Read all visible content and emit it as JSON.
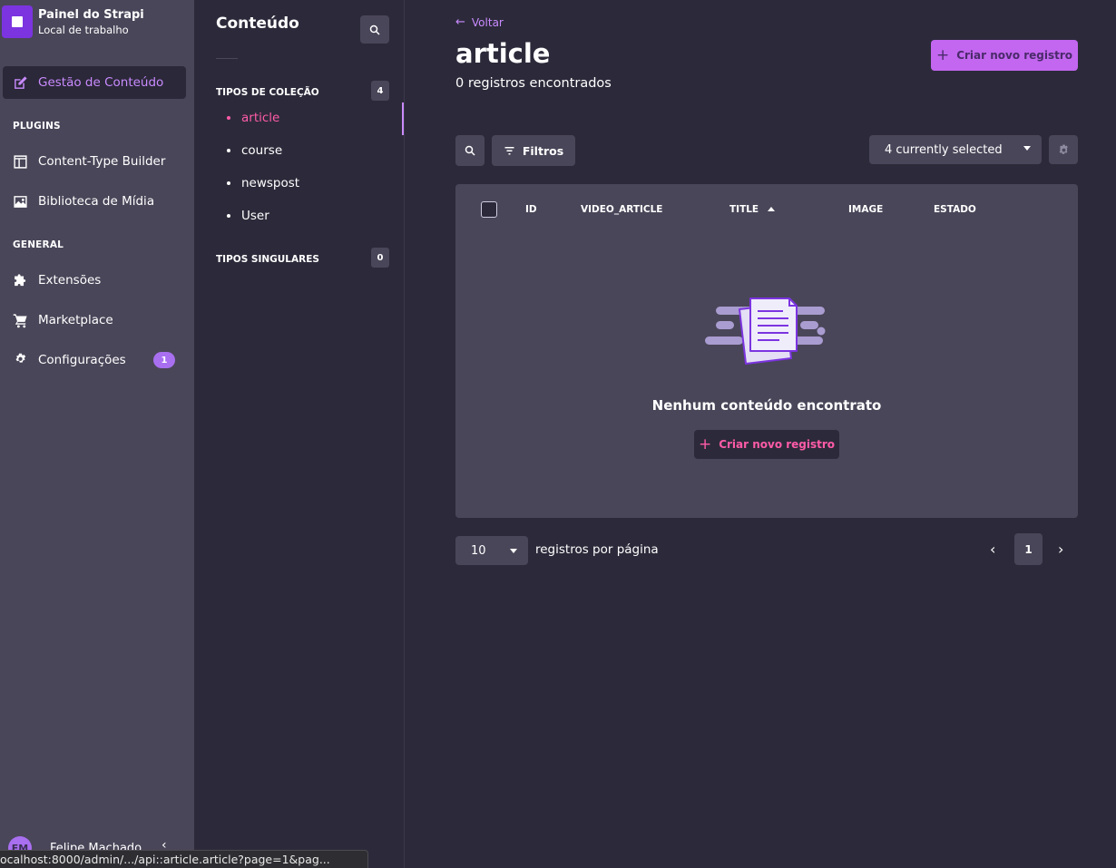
{
  "app": {
    "brand_title": "Painel do Strapi",
    "brand_subtitle": "Local de trabalho",
    "accent_color": "#c366f0",
    "active_color": "#ff5ba8"
  },
  "sidebar": {
    "active_item": {
      "label": "Gestão de Conteúdo",
      "icon": "pencil-icon"
    },
    "sections": [
      {
        "label": "PLUGINS",
        "items": [
          {
            "label": "Content-Type Builder",
            "icon": "layout-icon"
          },
          {
            "label": "Biblioteca de Mídia",
            "icon": "image-icon"
          }
        ]
      },
      {
        "label": "GENERAL",
        "items": [
          {
            "label": "Extensões",
            "icon": "puzzle-icon"
          },
          {
            "label": "Marketplace",
            "icon": "cart-icon"
          },
          {
            "label": "Configurações",
            "icon": "gear-icon",
            "badge": "1"
          }
        ]
      }
    ],
    "user": {
      "initials": "FM",
      "name": "Felipe Machado"
    }
  },
  "status_bar": {
    "url": "ocalhost:8000/admin/.../api::article.article?page=1&pag..."
  },
  "subnav": {
    "title": "Conteúdo",
    "collection_section": {
      "label": "TIPOS DE COLEÇÃO",
      "count": "4"
    },
    "collection_items": [
      "article",
      "course",
      "newspost",
      "User"
    ],
    "single_section": {
      "label": "TIPOS SINGULARES",
      "count": "0"
    }
  },
  "main": {
    "back_label": "Voltar",
    "title": "article",
    "subtitle": "0 registros encontrados",
    "create_label": "Criar novo registro",
    "filters_label": "Filtros",
    "columns_select": "4 currently selected",
    "table": {
      "columns": [
        "ID",
        "VIDEO_ARTICLE",
        "TITLE",
        "IMAGE",
        "ESTADO"
      ],
      "sorted_column": "TITLE",
      "sort_direction": "asc",
      "empty_text": "Nenhum conteúdo encontrato",
      "empty_create_label": "Criar novo registro"
    },
    "pagination": {
      "page_size": "10",
      "page_size_label": "registros por página",
      "current_page": "1"
    }
  }
}
